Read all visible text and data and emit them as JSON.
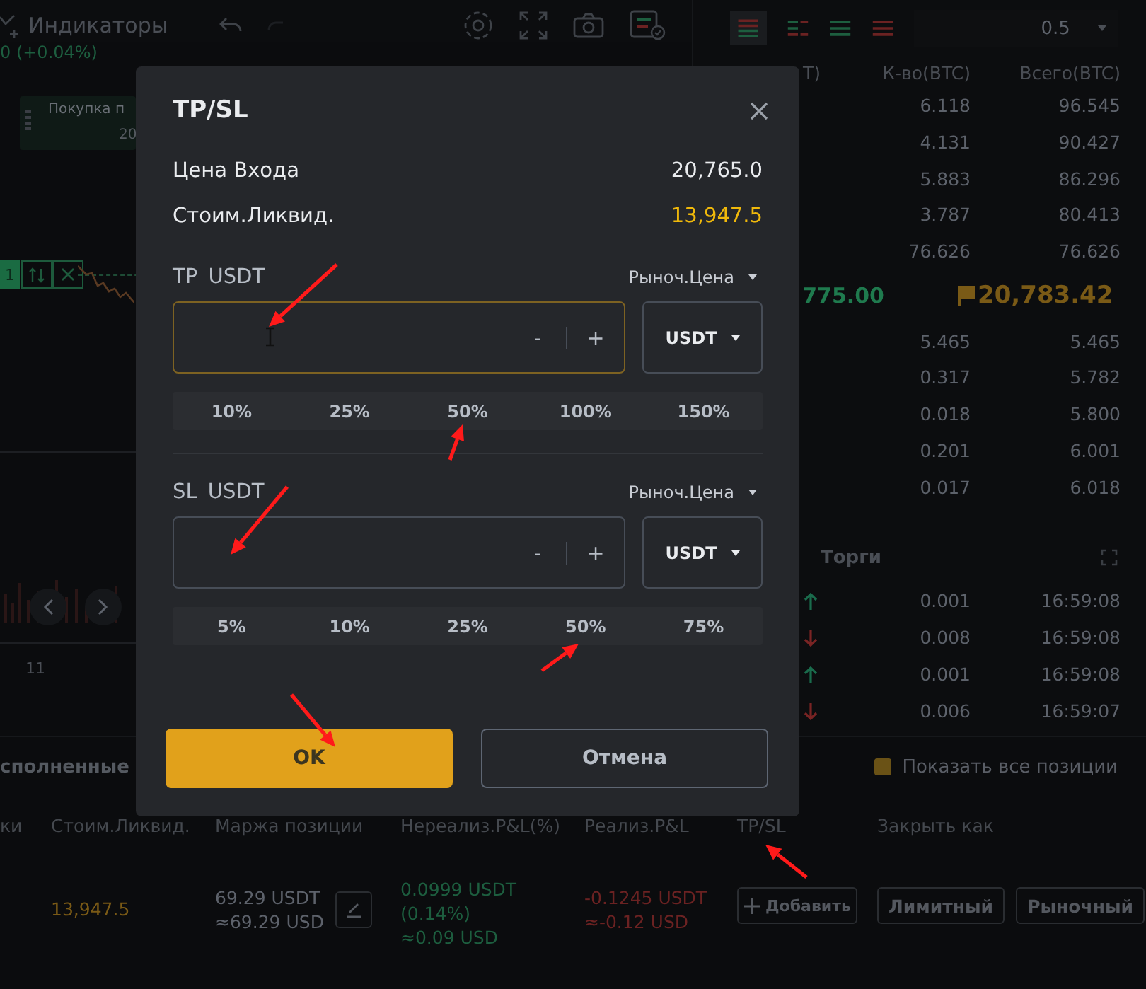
{
  "toolbar": {
    "indicators_label": "Индикаторы"
  },
  "chart": {
    "change": "0 (+0.04%)",
    "order_label": "Покупка п",
    "order_value": "20",
    "position_tag": "1",
    "axis_label": "11"
  },
  "orderbook": {
    "depth": "0.5",
    "columns": [
      "Т)",
      "К-во(BTC)",
      "Всего(BTC)"
    ],
    "asks": [
      {
        "qty": "6.118",
        "total": "96.545"
      },
      {
        "qty": "4.131",
        "total": "90.427"
      },
      {
        "qty": "5.883",
        "total": "86.296"
      },
      {
        "qty": "3.787",
        "total": "80.413"
      },
      {
        "qty": "76.626",
        "total": "76.626"
      }
    ],
    "last_price": "775.00",
    "mark_price": "20,783.42",
    "bids": [
      {
        "qty": "5.465",
        "total": "5.465"
      },
      {
        "qty": "0.317",
        "total": "5.782"
      },
      {
        "qty": "0.018",
        "total": "5.800"
      },
      {
        "qty": "0.201",
        "total": "6.001"
      },
      {
        "qty": "0.017",
        "total": "6.018"
      }
    ]
  },
  "trades": {
    "title": "Торги",
    "rows": [
      {
        "kind": "buy",
        "qty": "0.001",
        "time": "16:59:08"
      },
      {
        "kind": "sell",
        "qty": "0.008",
        "time": "16:59:08"
      },
      {
        "kind": "buy",
        "qty": "0.001",
        "time": "16:59:08"
      },
      {
        "kind": "sell",
        "qty": "0.006",
        "time": "16:59:07"
      }
    ]
  },
  "positions": {
    "tab": "сполненные",
    "show_all": {
      "label": "Показать все позиции",
      "checked": true
    },
    "columns": [
      "ки",
      "Стоим.Ликвид.",
      "Маржа позиции",
      "Нереализ.P&L(%)",
      "Реализ.P&L",
      "TP/SL",
      "Закрыть как"
    ],
    "row": {
      "liq_price": "13,947.5",
      "margin": [
        "69.29 USDT",
        "≈69.29 USD"
      ],
      "unrealized": [
        "0.0999 USDT",
        "(0.14%)",
        "≈0.09 USD"
      ],
      "realized": [
        "-0.1245 USDT",
        "≈-0.12 USD"
      ],
      "add_button": "Добавить",
      "close_buttons": [
        "Лимитный",
        "Рыночный"
      ]
    }
  },
  "dialog": {
    "title": "TP/SL",
    "info": [
      {
        "label": "Цена Входа",
        "value": "20,765.0",
        "kind": "plain"
      },
      {
        "label": "Стоим.Ликвид.",
        "value": "13,947.5",
        "kind": "liquidation"
      }
    ],
    "sections": [
      {
        "label": "TP USDT",
        "trigger": "Рыноч.Цена",
        "focused": true,
        "minus": "-",
        "plus": "+",
        "currency": "USDT",
        "presets": [
          "10%",
          "25%",
          "50%",
          "100%",
          "150%"
        ]
      },
      {
        "label": "SL USDT",
        "trigger": "Рыноч.Цена",
        "focused": false,
        "minus": "-",
        "plus": "+",
        "currency": "USDT",
        "presets": [
          "5%",
          "10%",
          "25%",
          "50%",
          "75%"
        ]
      }
    ],
    "buttons": [
      {
        "label": "OK",
        "kind": "primary"
      },
      {
        "label": "Отмена",
        "kind": "secondary"
      }
    ]
  }
}
